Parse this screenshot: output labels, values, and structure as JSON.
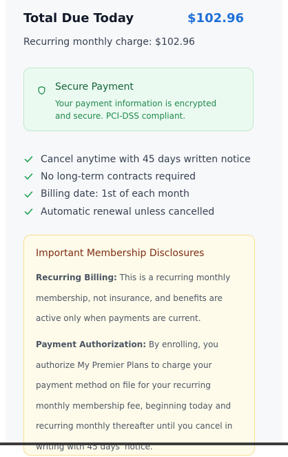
{
  "summary": {
    "total_label": "Total Due Today",
    "total_amount": "$102.96",
    "recurring_text": "Recurring monthly charge: $102.96"
  },
  "secure": {
    "icon": "shield-icon",
    "title": "Secure Payment",
    "text": "Your payment information is encrypted and secure. PCI-DSS compliant."
  },
  "features": [
    {
      "icon": "check-icon",
      "label": "Cancel anytime with 45 days written notice"
    },
    {
      "icon": "check-icon",
      "label": "No long-term contracts required"
    },
    {
      "icon": "check-icon",
      "label": "Billing date: 1st of each month"
    },
    {
      "icon": "check-icon",
      "label": "Automatic renewal unless cancelled"
    }
  ],
  "disclosures": {
    "title": "Important Membership Disclosures",
    "recurring_billing": {
      "heading": "Recurring Billing:",
      "text": " This is a recurring monthly membership, not insurance, and benefits are active only when payments are current."
    },
    "payment_authorization": {
      "heading": "Payment Authorization:",
      "text": " By enrolling, you authorize My Premier Plans to charge your payment method on file for your recurring monthly membership fee, beginning today and recurring monthly thereafter until you cancel in writing with 45 days' notice."
    }
  },
  "colors": {
    "accent_blue": "#1d6fd8",
    "success_green": "#22a455",
    "warning_bg": "#fffbea"
  }
}
